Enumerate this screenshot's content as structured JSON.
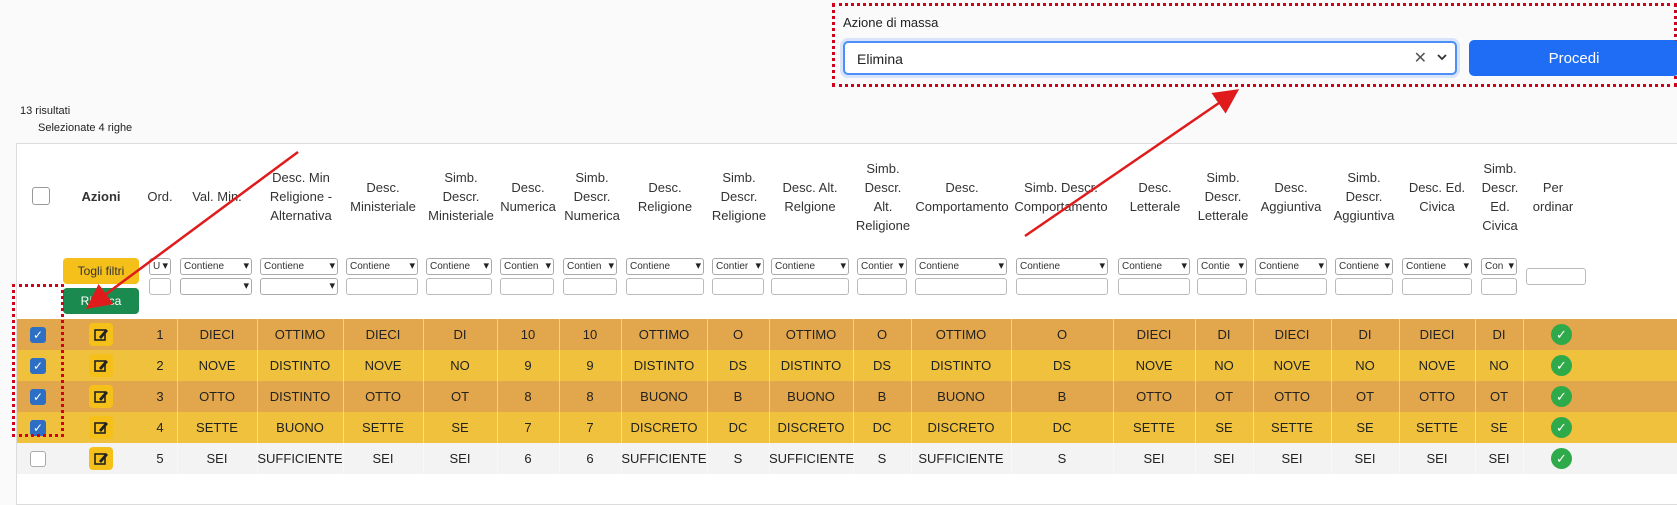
{
  "mass_action": {
    "label": "Azione di massa",
    "selected": "Elimina",
    "clear_icon": "close-icon",
    "dropdown_icon": "chevron-down-icon",
    "submit_label": "Procedi",
    "submit_color": "#1f6df5"
  },
  "results": {
    "count_text": "13 risultati",
    "selected_text": "Selezionate 4 righe"
  },
  "table": {
    "headers": {
      "azioni": "Azioni",
      "ord": "Ord.",
      "val_min": "Val. Min.",
      "desc_min_rel_alt": "Desc. Min Religione - Alternativa",
      "desc_ministeriale": "Desc. Ministeriale",
      "simb_descr_ministeriale": "Simb. Descr. Ministeriale",
      "desc_numerica": "Desc. Numerica",
      "simb_descr_numerica": "Simb. Descr. Numerica",
      "desc_religione": "Desc. Religione",
      "simb_descr_religione": "Simb. Descr. Religione",
      "desc_alt_religione": "Desc. Alt. Relgione",
      "simb_descr_alt_religione": "Simb. Descr. Alt. Religione",
      "desc_comportamento": "Desc. Comportamento",
      "simb_descr_comportamento": "Simb. Descr. Comportamento",
      "desc_letterale": "Desc. Letterale",
      "simb_descr_letterale": "Simb. Descr. Letterale",
      "desc_aggiuntiva": "Desc. Aggiuntiva",
      "simb_descr_aggiuntiva": "Simb. Descr. Aggiuntiva",
      "desc_ed_civica": "Desc. Ed. Civica",
      "simb_descr_ed_civica": "Simb. Descr. Ed. Civica",
      "per_ordinario": "Per ordinar"
    },
    "filters": {
      "togli_filtri": "Togli filtri",
      "cerca": "Ricerca",
      "f_ord": "U",
      "f_valmin": "Contiene",
      "f_descminrel": "Contiene",
      "f_descmin": "Contiene",
      "f_simbmin": "Contiene",
      "f_descnum": "Contien",
      "f_simbnum": "Contien",
      "f_descrel": "Contiene",
      "f_simbrel": "Contier",
      "f_descalt": "Contiene",
      "f_simbalt": "Contier",
      "f_desccomp": "Contiene",
      "f_simbcomp": "Contiene",
      "f_desclett": "Contiene",
      "f_simblett": "Contie",
      "f_descagg": "Contiene",
      "f_simbagg": "Contiene",
      "f_descciv": "Contiene",
      "f_simbciv": "Con"
    },
    "rows": [
      {
        "selected": true,
        "ord": "1",
        "val": "DIECI",
        "rel_alt": "OTTIMO",
        "min": "DIECI",
        "s_min": "DI",
        "num": "10",
        "s_num": "10",
        "rel": "OTTIMO",
        "s_rel": "O",
        "alt": "OTTIMO",
        "s_alt": "O",
        "comp": "OTTIMO",
        "s_comp": "O",
        "lett": "DIECI",
        "s_lett": "DI",
        "agg": "DIECI",
        "s_agg": "DI",
        "civ": "DIECI",
        "s_civ": "DI",
        "bg": "#e2a74c"
      },
      {
        "selected": true,
        "ord": "2",
        "val": "NOVE",
        "rel_alt": "DISTINTO",
        "min": "NOVE",
        "s_min": "NO",
        "num": "9",
        "s_num": "9",
        "rel": "DISTINTO",
        "s_rel": "DS",
        "alt": "DISTINTO",
        "s_alt": "DS",
        "comp": "DISTINTO",
        "s_comp": "DS",
        "lett": "NOVE",
        "s_lett": "NO",
        "agg": "NOVE",
        "s_agg": "NO",
        "civ": "NOVE",
        "s_civ": "NO",
        "bg": "#efc13c"
      },
      {
        "selected": true,
        "ord": "3",
        "val": "OTTO",
        "rel_alt": "DISTINTO",
        "min": "OTTO",
        "s_min": "OT",
        "num": "8",
        "s_num": "8",
        "rel": "BUONO",
        "s_rel": "B",
        "alt": "BUONO",
        "s_alt": "B",
        "comp": "BUONO",
        "s_comp": "B",
        "lett": "OTTO",
        "s_lett": "OT",
        "agg": "OTTO",
        "s_agg": "OT",
        "civ": "OTTO",
        "s_civ": "OT",
        "bg": "#e2a74c"
      },
      {
        "selected": true,
        "ord": "4",
        "val": "SETTE",
        "rel_alt": "BUONO",
        "min": "SETTE",
        "s_min": "SE",
        "num": "7",
        "s_num": "7",
        "rel": "DISCRETO",
        "s_rel": "DC",
        "alt": "DISCRETO",
        "s_alt": "DC",
        "comp": "DISCRETO",
        "s_comp": "DC",
        "lett": "SETTE",
        "s_lett": "SE",
        "agg": "SETTE",
        "s_agg": "SE",
        "civ": "SETTE",
        "s_civ": "SE",
        "bg": "#efc13c"
      },
      {
        "selected": false,
        "ord": "5",
        "val": "SEI",
        "rel_alt": "SUFFICIENTE",
        "min": "SEI",
        "s_min": "SEI",
        "num": "6",
        "s_num": "6",
        "rel": "SUFFICIENTE",
        "s_rel": "S",
        "alt": "SUFFICIENTE",
        "s_alt": "S",
        "comp": "SUFFICIENTE",
        "s_comp": "S",
        "lett": "SEI",
        "s_lett": "SEI",
        "agg": "SEI",
        "s_agg": "SEI",
        "civ": "SEI",
        "s_civ": "SEI",
        "bg": "#f3f3f3"
      }
    ]
  },
  "colors": {
    "highlight": "#d0021b",
    "edit_button": "#f5c01a",
    "status_ok": "#2eaa4a"
  }
}
